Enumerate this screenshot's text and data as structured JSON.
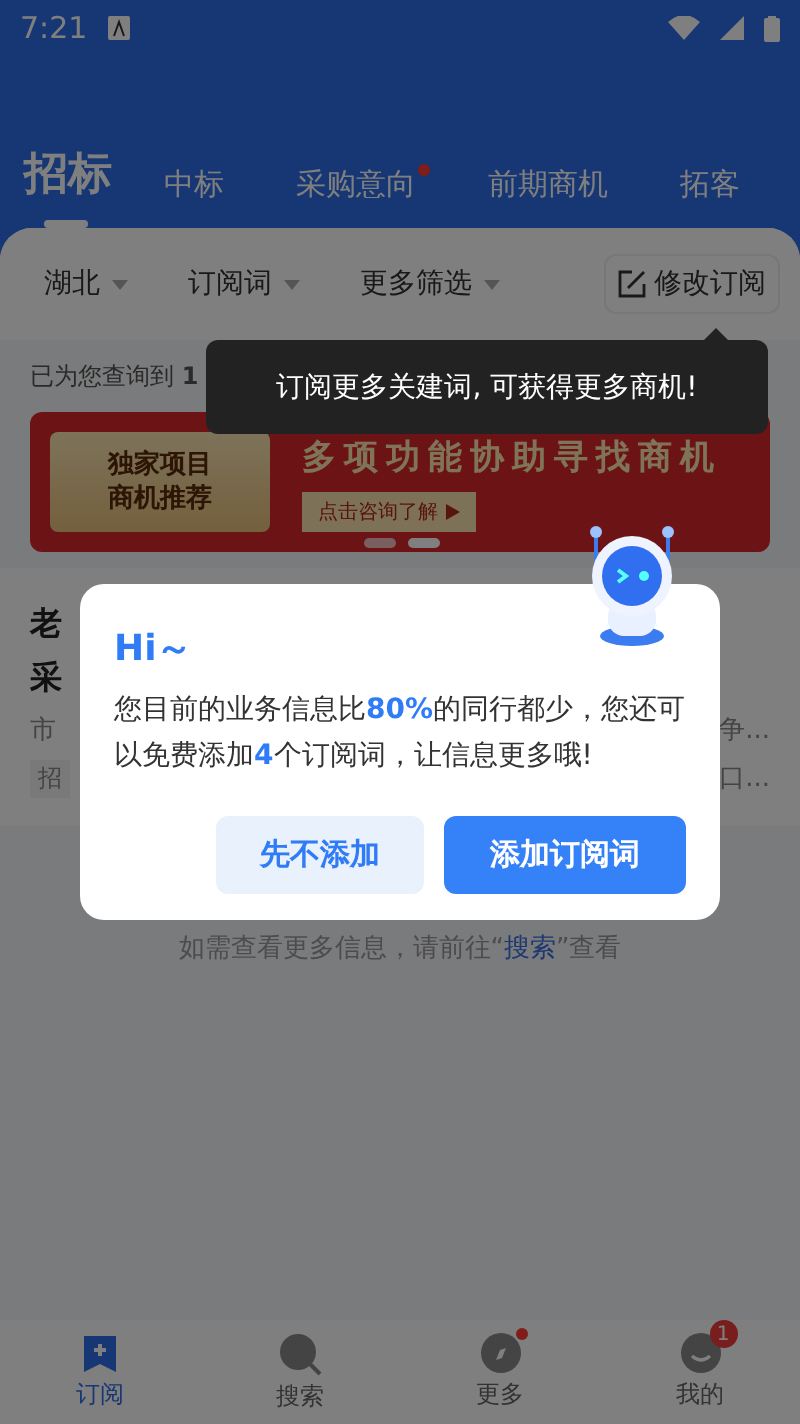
{
  "status_bar": {
    "time": "7:21"
  },
  "tabs": [
    {
      "label": "招标",
      "selected": true,
      "dot": false
    },
    {
      "label": "中标",
      "selected": false,
      "dot": false
    },
    {
      "label": "采购意向",
      "selected": false,
      "dot": true
    },
    {
      "label": "前期商机",
      "selected": false,
      "dot": false
    },
    {
      "label": "拓客",
      "selected": false,
      "dot": false
    }
  ],
  "filters": [
    "湖北",
    "订阅词",
    "更多筛选"
  ],
  "edit_button": "修改订阅",
  "result_count": "已为您查询到 **1**",
  "tooltip": "订阅更多关建词, 可获得更多商机!",
  "banner": {
    "badge_line_1": "独家项目",
    "badge_line_2": "商机推荐",
    "headline": "多项功能协助寻找商机",
    "button": "点击咨询了解"
  },
  "result": {
    "title_line_1": "老",
    "title_line_2": "采",
    "snippet_start": "市",
    "snippet_end": "争...",
    "tag": "招",
    "tag_end": "口..."
  },
  "notice": "如需查看更多信息，请前往“**搜索**”查看",
  "dialog": {
    "greeting": "Hi～",
    "message": "您目前的业务信息比**80%**的同行都少，您还可以免费添加**4**个订阅词，让信息更多哦!",
    "buttons": [
      {
        "label": "先不添加",
        "kind": "secondary"
      },
      {
        "label": "添加订阅词",
        "kind": "primary"
      }
    ]
  },
  "bottom_nav": [
    {
      "label": "订阅",
      "selected": true,
      "dot": false
    },
    {
      "label": "搜索",
      "selected": false,
      "dot": false
    },
    {
      "label": "更多",
      "selected": false,
      "dot": true
    },
    {
      "label": "我的",
      "selected": false,
      "dot": false,
      "badge": "1"
    }
  ]
}
